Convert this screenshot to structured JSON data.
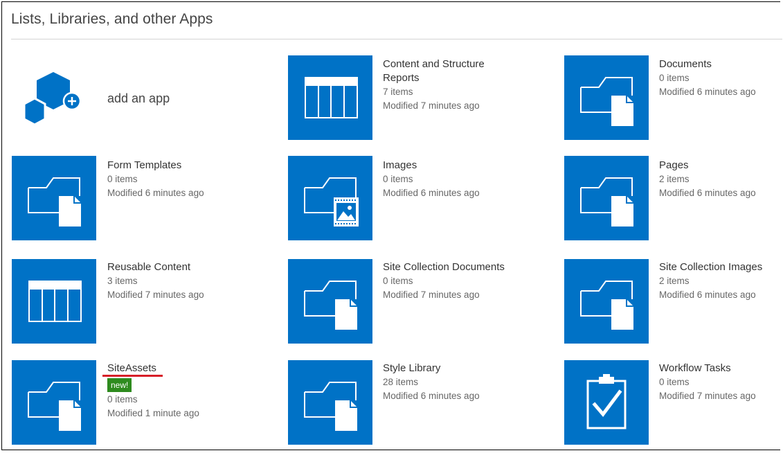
{
  "page": {
    "title": "Lists, Libraries, and other Apps"
  },
  "add_app": {
    "label": "add an app"
  },
  "apps": [
    {
      "id": "content-structure-reports",
      "name": "Content and Structure Reports",
      "items": "7 items",
      "modified": "Modified 7 minutes ago",
      "icon": "list-icon"
    },
    {
      "id": "documents",
      "name": "Documents",
      "items": "0 items",
      "modified": "Modified 6 minutes ago",
      "icon": "folder-document-icon"
    },
    {
      "id": "form-templates",
      "name": "Form Templates",
      "items": "0 items",
      "modified": "Modified 6 minutes ago",
      "icon": "folder-document-icon"
    },
    {
      "id": "images",
      "name": "Images",
      "items": "0 items",
      "modified": "Modified 6 minutes ago",
      "icon": "folder-image-icon"
    },
    {
      "id": "pages",
      "name": "Pages",
      "items": "2 items",
      "modified": "Modified 6 minutes ago",
      "icon": "folder-document-icon"
    },
    {
      "id": "reusable-content",
      "name": "Reusable Content",
      "items": "3 items",
      "modified": "Modified 7 minutes ago",
      "icon": "list-icon"
    },
    {
      "id": "site-collection-documents",
      "name": "Site Collection Documents",
      "items": "0 items",
      "modified": "Modified 7 minutes ago",
      "icon": "folder-document-icon"
    },
    {
      "id": "site-collection-images",
      "name": "Site Collection Images",
      "items": "2 items",
      "modified": "Modified 6 minutes ago",
      "icon": "folder-document-icon"
    },
    {
      "id": "siteassets",
      "name": "SiteAssets",
      "badge": "new!",
      "items": "0 items",
      "modified": "Modified 1 minute ago",
      "icon": "folder-document-icon"
    },
    {
      "id": "style-library",
      "name": "Style Library",
      "items": "28 items",
      "modified": "Modified 6 minutes ago",
      "icon": "folder-document-icon"
    },
    {
      "id": "workflow-tasks",
      "name": "Workflow Tasks",
      "items": "0 items",
      "modified": "Modified 7 minutes ago",
      "icon": "task-clipboard-icon"
    }
  ],
  "colors": {
    "tile": "#0072c6",
    "badge": "#2e8b1e",
    "highlight_underline": "#d71e28"
  }
}
